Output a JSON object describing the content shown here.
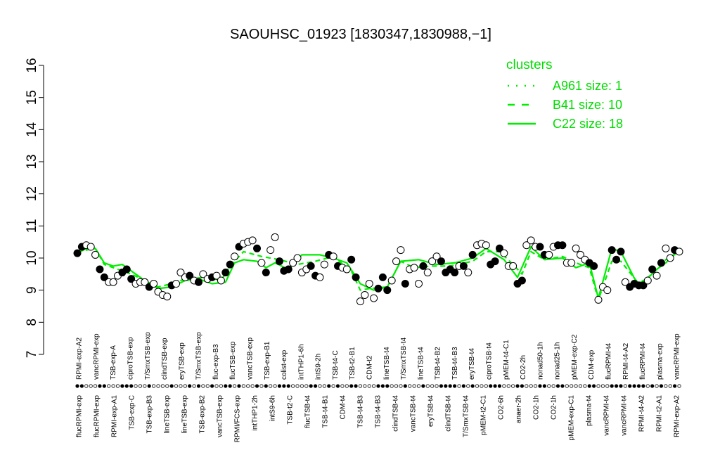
{
  "chart_data": {
    "type": "line",
    "title": "SAOUHSC_01923 [1830347,1830988,−1]",
    "xlabel": "",
    "ylabel": "",
    "ylim": [
      7,
      16
    ],
    "yticks": [
      "7",
      "8",
      "9",
      "10",
      "11",
      "12",
      "13",
      "14",
      "15",
      "16"
    ],
    "x_labels_top": [
      "RPMI-exp-A2",
      "vancRPMI-exp",
      "TSB-exp-A",
      "ciproTSB-exp",
      "T/SmxTSB-exp",
      "clindTSB-exp",
      "eryTSB-exp",
      "T/SmxTSB-exp",
      "fluc-exp-B3",
      "flucTSB-exp",
      "vancTSB-exp",
      "TSB-exp-B1",
      "colist-exp",
      "intTHP1-6h",
      "intS9-2h",
      "TSB-t4-C",
      "TSB-t2-B1",
      "CDM-t2",
      "lineTSB-t4",
      "T/SmxTSB-t4",
      "lineTSB-t4",
      "TSB-t4-B2",
      "TSB-t4-B3",
      "eryTSB-t4",
      "ciproTSB-t4",
      "pMEM-t4-C1",
      "CO2-2h",
      "nonad50-1h",
      "nonad25-1h",
      "pMEM-exp-C2",
      "CDM-exp",
      "flucRPMI-t4",
      "RPMI-t4-A2",
      "flucRPMI-t4",
      "plasma-exp",
      "vancRPMI-exp"
    ],
    "x_labels_bottom": [
      "flucRPMI-exp",
      "flucRPMI-exp",
      "RPMI-exp-A1",
      "TSB-exp-C",
      "TSB-exp-B3",
      "lineTSB-exp",
      "lineTSB-exp",
      "TSB-exp-B2",
      "vancTSB-exp",
      "RPMI/FCS-exp",
      "intTHP1-2h",
      "intS9-6h",
      "TSB-t2-C",
      "flucTSB-t4",
      "TSB-t4-B1",
      "CDM-t4",
      "TSB-t4-B3",
      "TSB-t4-B3",
      "clindTSB-t4",
      "vancTSB-t4",
      "eryTSB-t4",
      "clindTSB-t4",
      "T/SmxTSB-t4",
      "pMEM-t2-C1",
      "CO2-6h",
      "anaer-2h",
      "CO2-1h",
      "CO2-1h",
      "pMEM-exp-C1",
      "plasma-t4",
      "vancRPMI-t4",
      "vancRPMI-t4",
      "RPMI-t4-A2",
      "RPMI-t2-A1",
      "RPMI-exp-A2"
    ],
    "points": [
      {
        "x": 1,
        "y": 10.15,
        "filled": true
      },
      {
        "x": 2,
        "y": 10.35,
        "filled": true
      },
      {
        "x": 3,
        "y": 10.4,
        "filled": false
      },
      {
        "x": 4,
        "y": 10.35,
        "filled": false
      },
      {
        "x": 5,
        "y": 10.1,
        "filled": false
      },
      {
        "x": 6,
        "y": 9.65,
        "filled": true
      },
      {
        "x": 7,
        "y": 9.4,
        "filled": true
      },
      {
        "x": 8,
        "y": 9.25,
        "filled": false
      },
      {
        "x": 9,
        "y": 9.25,
        "filled": false
      },
      {
        "x": 10,
        "y": 9.45,
        "filled": false
      },
      {
        "x": 11,
        "y": 9.55,
        "filled": true
      },
      {
        "x": 12,
        "y": 9.65,
        "filled": true
      },
      {
        "x": 13,
        "y": 9.35,
        "filled": true
      },
      {
        "x": 14,
        "y": 9.2,
        "filled": false
      },
      {
        "x": 15,
        "y": 9.25,
        "filled": false
      },
      {
        "x": 16,
        "y": 9.25,
        "filled": false
      },
      {
        "x": 17,
        "y": 9.1,
        "filled": true
      },
      {
        "x": 18,
        "y": 9.2,
        "filled": false
      },
      {
        "x": 19,
        "y": 8.95,
        "filled": false
      },
      {
        "x": 20,
        "y": 8.85,
        "filled": false
      },
      {
        "x": 21,
        "y": 8.8,
        "filled": false
      },
      {
        "x": 22,
        "y": 9.15,
        "filled": true
      },
      {
        "x": 23,
        "y": 9.2,
        "filled": false
      },
      {
        "x": 24,
        "y": 9.55,
        "filled": false
      },
      {
        "x": 25,
        "y": 9.4,
        "filled": false
      },
      {
        "x": 26,
        "y": 9.45,
        "filled": true
      },
      {
        "x": 27,
        "y": 9.3,
        "filled": false
      },
      {
        "x": 28,
        "y": 9.25,
        "filled": true
      },
      {
        "x": 29,
        "y": 9.5,
        "filled": false
      },
      {
        "x": 30,
        "y": 9.35,
        "filled": false
      },
      {
        "x": 31,
        "y": 9.4,
        "filled": true
      },
      {
        "x": 32,
        "y": 9.45,
        "filled": false
      },
      {
        "x": 33,
        "y": 9.3,
        "filled": false
      },
      {
        "x": 34,
        "y": 9.55,
        "filled": true
      },
      {
        "x": 35,
        "y": 9.8,
        "filled": true
      },
      {
        "x": 36,
        "y": 10.05,
        "filled": false
      },
      {
        "x": 37,
        "y": 10.35,
        "filled": true
      },
      {
        "x": 38,
        "y": 10.45,
        "filled": false
      },
      {
        "x": 39,
        "y": 10.5,
        "filled": false
      },
      {
        "x": 40,
        "y": 10.55,
        "filled": false
      },
      {
        "x": 41,
        "y": 10.3,
        "filled": true
      },
      {
        "x": 42,
        "y": 9.85,
        "filled": false
      },
      {
        "x": 43,
        "y": 9.55,
        "filled": true
      },
      {
        "x": 44,
        "y": 10.25,
        "filled": false
      },
      {
        "x": 45,
        "y": 10.65,
        "filled": false
      },
      {
        "x": 46,
        "y": 9.9,
        "filled": true
      },
      {
        "x": 47,
        "y": 9.6,
        "filled": true
      },
      {
        "x": 48,
        "y": 9.65,
        "filled": true
      },
      {
        "x": 49,
        "y": 9.85,
        "filled": false
      },
      {
        "x": 50,
        "y": 10.0,
        "filled": false
      },
      {
        "x": 51,
        "y": 9.55,
        "filled": false
      },
      {
        "x": 52,
        "y": 9.65,
        "filled": false
      },
      {
        "x": 53,
        "y": 9.75,
        "filled": true
      },
      {
        "x": 54,
        "y": 9.45,
        "filled": true
      },
      {
        "x": 55,
        "y": 9.4,
        "filled": false
      },
      {
        "x": 56,
        "y": 9.8,
        "filled": false
      },
      {
        "x": 57,
        "y": 10.1,
        "filled": true
      },
      {
        "x": 58,
        "y": 10.05,
        "filled": false
      },
      {
        "x": 59,
        "y": 9.75,
        "filled": true
      },
      {
        "x": 60,
        "y": 9.7,
        "filled": false
      },
      {
        "x": 61,
        "y": 9.65,
        "filled": false
      },
      {
        "x": 62,
        "y": 9.95,
        "filled": true
      },
      {
        "x": 63,
        "y": 9.4,
        "filled": true
      },
      {
        "x": 64,
        "y": 8.65,
        "filled": false
      },
      {
        "x": 65,
        "y": 8.85,
        "filled": false
      },
      {
        "x": 66,
        "y": 9.2,
        "filled": false
      },
      {
        "x": 67,
        "y": 8.75,
        "filled": false
      },
      {
        "x": 68,
        "y": 9.05,
        "filled": true
      },
      {
        "x": 69,
        "y": 9.4,
        "filled": true
      },
      {
        "x": 70,
        "y": 9.0,
        "filled": true
      },
      {
        "x": 71,
        "y": 9.3,
        "filled": false
      },
      {
        "x": 72,
        "y": 9.9,
        "filled": false
      },
      {
        "x": 73,
        "y": 10.25,
        "filled": false
      },
      {
        "x": 74,
        "y": 9.2,
        "filled": true
      },
      {
        "x": 75,
        "y": 9.65,
        "filled": false
      },
      {
        "x": 76,
        "y": 9.7,
        "filled": false
      },
      {
        "x": 77,
        "y": 9.2,
        "filled": false
      },
      {
        "x": 78,
        "y": 9.75,
        "filled": true
      },
      {
        "x": 79,
        "y": 9.55,
        "filled": false
      },
      {
        "x": 80,
        "y": 9.9,
        "filled": false
      },
      {
        "x": 81,
        "y": 10.05,
        "filled": false
      },
      {
        "x": 82,
        "y": 9.9,
        "filled": true
      },
      {
        "x": 83,
        "y": 9.55,
        "filled": true
      },
      {
        "x": 84,
        "y": 9.65,
        "filled": true
      },
      {
        "x": 85,
        "y": 9.55,
        "filled": true
      },
      {
        "x": 86,
        "y": 9.75,
        "filled": false
      },
      {
        "x": 87,
        "y": 9.75,
        "filled": true
      },
      {
        "x": 88,
        "y": 9.55,
        "filled": false
      },
      {
        "x": 89,
        "y": 10.1,
        "filled": true
      },
      {
        "x": 90,
        "y": 10.4,
        "filled": false
      },
      {
        "x": 91,
        "y": 10.45,
        "filled": false
      },
      {
        "x": 92,
        "y": 10.4,
        "filled": false
      },
      {
        "x": 93,
        "y": 9.8,
        "filled": true
      },
      {
        "x": 94,
        "y": 9.9,
        "filled": true
      },
      {
        "x": 95,
        "y": 10.3,
        "filled": true
      },
      {
        "x": 96,
        "y": 10.15,
        "filled": false
      },
      {
        "x": 97,
        "y": 9.75,
        "filled": false
      },
      {
        "x": 98,
        "y": 9.75,
        "filled": false
      },
      {
        "x": 99,
        "y": 9.2,
        "filled": true
      },
      {
        "x": 100,
        "y": 9.3,
        "filled": true
      },
      {
        "x": 101,
        "y": 10.4,
        "filled": false
      },
      {
        "x": 102,
        "y": 10.55,
        "filled": false
      },
      {
        "x": 103,
        "y": 10.35,
        "filled": false
      },
      {
        "x": 104,
        "y": 10.35,
        "filled": true
      },
      {
        "x": 105,
        "y": 10.1,
        "filled": true
      },
      {
        "x": 106,
        "y": 10.1,
        "filled": false
      },
      {
        "x": 107,
        "y": 10.35,
        "filled": false
      },
      {
        "x": 108,
        "y": 10.4,
        "filled": true
      },
      {
        "x": 109,
        "y": 10.4,
        "filled": true
      },
      {
        "x": 110,
        "y": 9.85,
        "filled": false
      },
      {
        "x": 111,
        "y": 9.85,
        "filled": false
      },
      {
        "x": 112,
        "y": 10.3,
        "filled": false
      },
      {
        "x": 113,
        "y": 10.1,
        "filled": false
      },
      {
        "x": 114,
        "y": 9.95,
        "filled": false
      },
      {
        "x": 115,
        "y": 9.85,
        "filled": true
      },
      {
        "x": 116,
        "y": 9.75,
        "filled": true
      },
      {
        "x": 117,
        "y": 8.7,
        "filled": false
      },
      {
        "x": 118,
        "y": 9.1,
        "filled": false
      },
      {
        "x": 119,
        "y": 9.0,
        "filled": false
      },
      {
        "x": 120,
        "y": 10.25,
        "filled": true
      },
      {
        "x": 121,
        "y": 9.95,
        "filled": true
      },
      {
        "x": 122,
        "y": 10.2,
        "filled": true
      },
      {
        "x": 123,
        "y": 9.25,
        "filled": false
      },
      {
        "x": 124,
        "y": 9.1,
        "filled": true
      },
      {
        "x": 125,
        "y": 9.2,
        "filled": true
      },
      {
        "x": 126,
        "y": 9.15,
        "filled": true
      },
      {
        "x": 127,
        "y": 9.15,
        "filled": true
      },
      {
        "x": 128,
        "y": 9.3,
        "filled": false
      },
      {
        "x": 129,
        "y": 9.65,
        "filled": true
      },
      {
        "x": 130,
        "y": 9.45,
        "filled": false
      },
      {
        "x": 131,
        "y": 9.85,
        "filled": true
      },
      {
        "x": 132,
        "y": 10.3,
        "filled": false
      },
      {
        "x": 133,
        "y": 10.0,
        "filled": false
      },
      {
        "x": 134,
        "y": 10.25,
        "filled": true
      },
      {
        "x": 135,
        "y": 10.2,
        "filled": false
      }
    ],
    "series": [
      {
        "name": "A961 size: 1",
        "style": "dotted",
        "values": []
      },
      {
        "name": "B41 size: 10",
        "style": "dashed",
        "values": [
          [
            1,
            10.2
          ],
          [
            5,
            10.3
          ],
          [
            7,
            9.8
          ],
          [
            10,
            9.65
          ],
          [
            13,
            9.5
          ],
          [
            16,
            9.3
          ],
          [
            19,
            9.1
          ],
          [
            22,
            9.2
          ],
          [
            25,
            9.35
          ],
          [
            30,
            9.4
          ],
          [
            33,
            9.3
          ],
          [
            35,
            9.75
          ],
          [
            38,
            10.2
          ],
          [
            42,
            10.05
          ],
          [
            46,
            9.95
          ],
          [
            50,
            9.8
          ],
          [
            54,
            9.9
          ],
          [
            58,
            10.05
          ],
          [
            62,
            9.6
          ],
          [
            64,
            9.0
          ],
          [
            66,
            9.05
          ],
          [
            70,
            9.1
          ],
          [
            73,
            9.9
          ],
          [
            76,
            9.7
          ],
          [
            80,
            9.75
          ],
          [
            84,
            9.75
          ],
          [
            89,
            9.9
          ],
          [
            92,
            10.2
          ],
          [
            95,
            10.2
          ],
          [
            98,
            9.8
          ],
          [
            100,
            9.5
          ],
          [
            102,
            10.2
          ],
          [
            105,
            9.95
          ],
          [
            109,
            10.05
          ],
          [
            112,
            9.85
          ],
          [
            115,
            9.7
          ],
          [
            117,
            8.7
          ],
          [
            120,
            9.9
          ],
          [
            122,
            9.9
          ],
          [
            126,
            9.2
          ],
          [
            129,
            9.5
          ],
          [
            132,
            9.95
          ],
          [
            135,
            10.2
          ]
        ]
      },
      {
        "name": "C22 size: 18",
        "style": "solid",
        "values": [
          [
            1,
            10.15
          ],
          [
            3,
            10.3
          ],
          [
            5,
            10.3
          ],
          [
            7,
            9.85
          ],
          [
            9,
            9.75
          ],
          [
            11,
            9.8
          ],
          [
            13,
            9.6
          ],
          [
            16,
            9.3
          ],
          [
            19,
            9.05
          ],
          [
            22,
            9.1
          ],
          [
            25,
            9.3
          ],
          [
            28,
            9.35
          ],
          [
            31,
            9.2
          ],
          [
            34,
            9.25
          ],
          [
            36,
            9.85
          ],
          [
            38,
            9.95
          ],
          [
            41,
            9.9
          ],
          [
            43,
            9.7
          ],
          [
            45,
            9.85
          ],
          [
            48,
            9.65
          ],
          [
            51,
            10.1
          ],
          [
            55,
            10.1
          ],
          [
            58,
            10.0
          ],
          [
            61,
            9.85
          ],
          [
            64,
            9.2
          ],
          [
            67,
            9.0
          ],
          [
            70,
            9.1
          ],
          [
            73,
            9.9
          ],
          [
            77,
            9.95
          ],
          [
            81,
            9.8
          ],
          [
            85,
            9.85
          ],
          [
            89,
            10.0
          ],
          [
            92,
            10.3
          ],
          [
            96,
            9.95
          ],
          [
            99,
            9.4
          ],
          [
            102,
            10.35
          ],
          [
            105,
            9.95
          ],
          [
            109,
            10.0
          ],
          [
            112,
            9.7
          ],
          [
            115,
            9.85
          ],
          [
            117,
            8.75
          ],
          [
            120,
            10.3
          ],
          [
            122,
            10.2
          ],
          [
            126,
            9.1
          ],
          [
            130,
            9.65
          ],
          [
            132,
            9.85
          ],
          [
            135,
            10.25
          ]
        ]
      }
    ],
    "legend": {
      "title": "clusters",
      "placement": "top-right",
      "entries": [
        {
          "label": "A961 size: 1",
          "style": "dotted"
        },
        {
          "label": "B41 size: 10",
          "style": "dashed"
        },
        {
          "label": "C22 size: 18",
          "style": "solid"
        }
      ]
    },
    "colors": {
      "line": "#00ee00",
      "legend_text": "#00dd00",
      "points": "#000000"
    },
    "grid": false
  }
}
